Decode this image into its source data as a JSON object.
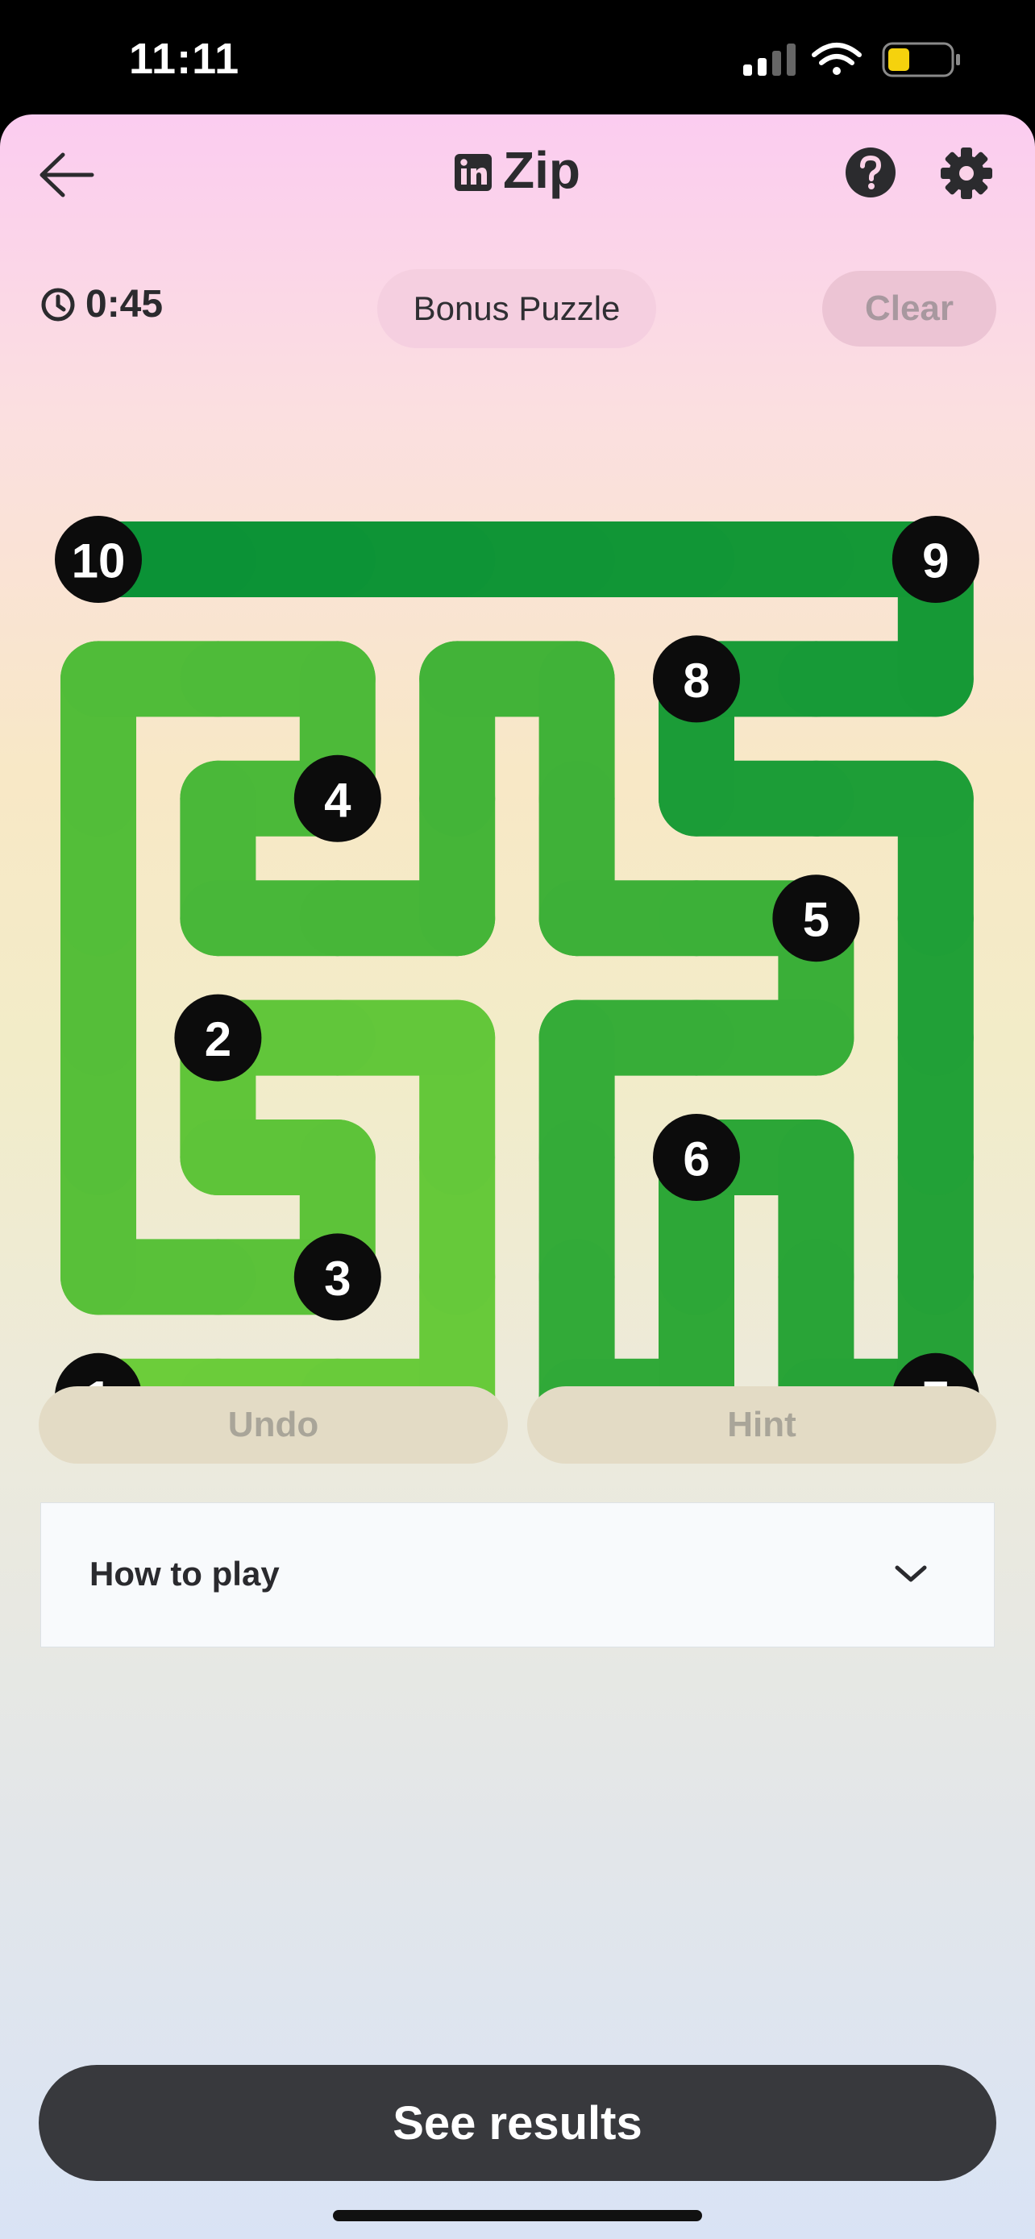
{
  "status_bar": {
    "time": "11:11"
  },
  "header": {
    "title": "Zip",
    "back_icon": "arrow-left-icon",
    "help_icon": "help-icon",
    "settings_icon": "gear-icon"
  },
  "toolbar": {
    "timer": "0:45",
    "mode_label": "Bonus Puzzle",
    "clear_label": "Clear"
  },
  "board": {
    "cols": 8,
    "rows": 8,
    "nodes": [
      {
        "label": "1",
        "col": 0,
        "row": 7
      },
      {
        "label": "2",
        "col": 1,
        "row": 4
      },
      {
        "label": "3",
        "col": 2,
        "row": 6
      },
      {
        "label": "4",
        "col": 2,
        "row": 2
      },
      {
        "label": "5",
        "col": 6,
        "row": 3
      },
      {
        "label": "6",
        "col": 5,
        "row": 5
      },
      {
        "label": "7",
        "col": 7,
        "row": 7
      },
      {
        "label": "8",
        "col": 5,
        "row": 1
      },
      {
        "label": "9",
        "col": 7,
        "row": 0
      },
      {
        "label": "10",
        "col": 0,
        "row": 0
      }
    ],
    "path": [
      [
        0,
        7
      ],
      [
        1,
        7
      ],
      [
        2,
        7
      ],
      [
        3,
        7
      ],
      [
        3,
        6
      ],
      [
        3,
        5
      ],
      [
        3,
        4
      ],
      [
        2,
        4
      ],
      [
        1,
        4
      ],
      [
        1,
        5
      ],
      [
        2,
        5
      ],
      [
        2,
        6
      ],
      [
        1,
        6
      ],
      [
        0,
        6
      ],
      [
        0,
        5
      ],
      [
        0,
        4
      ],
      [
        0,
        3
      ],
      [
        0,
        2
      ],
      [
        0,
        1
      ],
      [
        1,
        1
      ],
      [
        2,
        1
      ],
      [
        2,
        2
      ],
      [
        1,
        2
      ],
      [
        1,
        3
      ],
      [
        2,
        3
      ],
      [
        3,
        3
      ],
      [
        3,
        2
      ],
      [
        3,
        1
      ],
      [
        4,
        1
      ],
      [
        4,
        2
      ],
      [
        4,
        3
      ],
      [
        5,
        3
      ],
      [
        6,
        3
      ],
      [
        6,
        4
      ],
      [
        5,
        4
      ],
      [
        4,
        4
      ],
      [
        4,
        5
      ],
      [
        4,
        6
      ],
      [
        4,
        7
      ],
      [
        5,
        7
      ],
      [
        5,
        6
      ],
      [
        5,
        5
      ],
      [
        6,
        5
      ],
      [
        6,
        6
      ],
      [
        6,
        7
      ],
      [
        7,
        7
      ],
      [
        7,
        6
      ],
      [
        7,
        5
      ],
      [
        7,
        4
      ],
      [
        7,
        3
      ],
      [
        7,
        2
      ],
      [
        6,
        2
      ],
      [
        5,
        2
      ],
      [
        5,
        1
      ],
      [
        6,
        1
      ],
      [
        7,
        1
      ],
      [
        7,
        0
      ],
      [
        6,
        0
      ],
      [
        5,
        0
      ],
      [
        4,
        0
      ],
      [
        3,
        0
      ],
      [
        2,
        0
      ],
      [
        1,
        0
      ],
      [
        0,
        0
      ]
    ],
    "colors": {
      "start": "#6dcd3a",
      "end": "#0a9236"
    }
  },
  "controls": {
    "undo_label": "Undo",
    "hint_label": "Hint"
  },
  "how_to_play": {
    "label": "How to play"
  },
  "footer": {
    "see_results_label": "See results"
  }
}
